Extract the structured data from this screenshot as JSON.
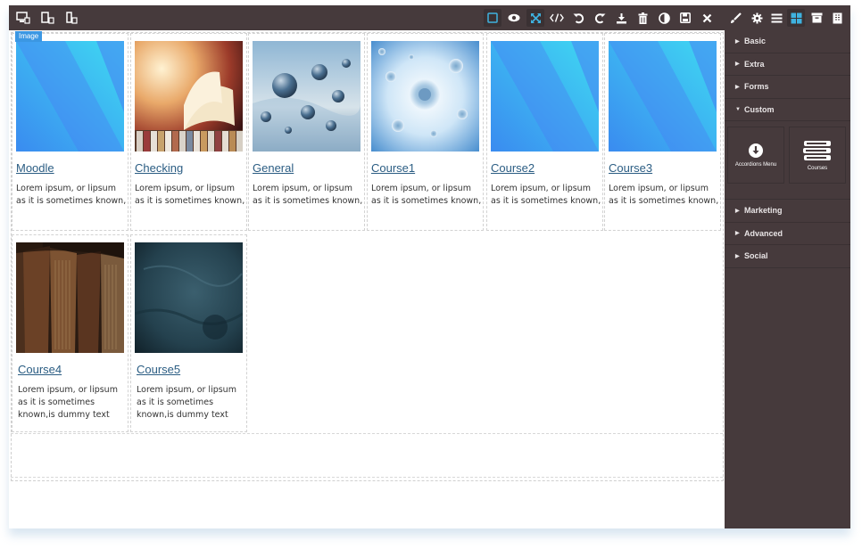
{
  "toolbar": {
    "left_icons": [
      "desktop-icon",
      "tablet-icon",
      "mobile-icon"
    ],
    "right_icons": [
      "sw-visibility-icon",
      "preview-eye-icon",
      "fullscreen-icon",
      "code-icon",
      "undo-icon",
      "redo-icon",
      "import-icon",
      "trash-icon",
      "contrast-icon",
      "save-icon",
      "close-icon"
    ],
    "panel_icons": [
      "brush-icon",
      "gear-icon",
      "layers-icon",
      "blocks-icon",
      "archive-icon",
      "pages-icon"
    ]
  },
  "canvas": {
    "selected_badge": "Image"
  },
  "cards": [
    {
      "title": "Moodle",
      "desc": "Lorem ipsum, or lipsum as it is sometimes known,",
      "image": "gradient-placeholder"
    },
    {
      "title": "Checking",
      "desc": "Lorem ipsum, or lipsum as it is sometimes known,",
      "image": "books"
    },
    {
      "title": "General",
      "desc": "Lorem ipsum, or lipsum as it is sometimes known,",
      "image": "spheres"
    },
    {
      "title": "Course1",
      "desc": "Lorem ipsum, or lipsum as it is sometimes known,",
      "image": "cells"
    },
    {
      "title": "Course2",
      "desc": "Lorem ipsum, or lipsum as it is sometimes known,",
      "image": "gradient-placeholder"
    },
    {
      "title": "Course3",
      "desc": "Lorem ipsum, or lipsum as it is sometimes known,",
      "image": "gradient-placeholder"
    },
    {
      "title": "Course4",
      "desc": "Lorem ipsum, or lipsum as it is sometimes known,is dummy text",
      "image": "old-books"
    },
    {
      "title": "Course5",
      "desc": "Lorem ipsum, or lipsum as it is sometimes known,is dummy text",
      "image": "dark-texture"
    }
  ],
  "panel": {
    "sections_top": [
      "Basic",
      "Extra",
      "Forms",
      "Custom"
    ],
    "blocks": [
      {
        "label": "Accordions Menu",
        "icon": "arrow-circle-down-icon"
      },
      {
        "label": "Courses",
        "icon": "books-stack-icon"
      }
    ],
    "sections_bottom": [
      "Marketing",
      "Advanced",
      "Social"
    ]
  },
  "colors": {
    "toolbar_bg": "#463a3c",
    "accent": "#3fb2e0",
    "link": "#2b5d83",
    "badge": "#3b97e3"
  }
}
